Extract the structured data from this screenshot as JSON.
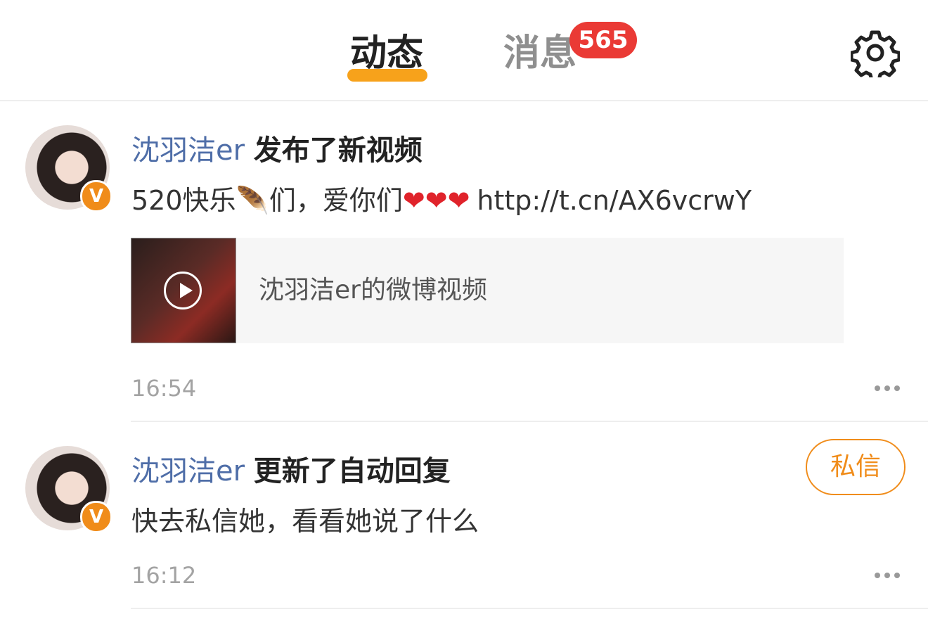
{
  "header": {
    "tabs": [
      {
        "label": "动态",
        "active": true
      },
      {
        "label": "消息",
        "active": false
      }
    ],
    "message_badge": "565",
    "settings_icon": "gear-icon",
    "accent_color": "#f7a21b",
    "badge_color": "#ea3a35"
  },
  "feed": [
    {
      "username": "沈羽洁er",
      "action": "发布了新视频",
      "text_prefix": "520快乐",
      "text_mid": "们，爱你们",
      "hearts": [
        "❤",
        "❤",
        "❤"
      ],
      "url": "http://t.cn/AX6vcrwY",
      "video_card_title": "沈羽洁er的微博视频",
      "time": "16:54",
      "avatar_badge": "V"
    },
    {
      "username": "沈羽洁er",
      "action": "更新了自动回复",
      "text": "快去私信她，看看她说了什么",
      "time": "16:12",
      "avatar_badge": "V",
      "action_button": "私信"
    }
  ]
}
